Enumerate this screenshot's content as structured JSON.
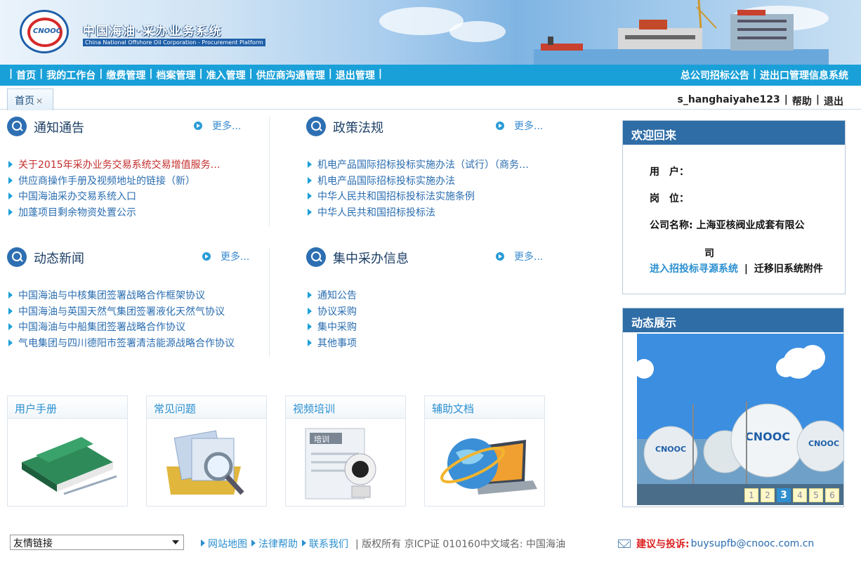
{
  "header": {
    "brand_title": "中国海油·采办业务系统",
    "brand_subtitle": "China National Offshore Oil Corporation - Procurement Platform",
    "logo_text": "CNOOC"
  },
  "nav": {
    "left": [
      "首页",
      "我的工作台",
      "缴费管理",
      "档案管理",
      "准入管理",
      "供应商沟通管理",
      "退出管理"
    ],
    "right": [
      "总公司招标公告",
      "进出口管理信息系统"
    ]
  },
  "tabs": {
    "home": "首页"
  },
  "userbar": {
    "username": "s_hanghaiyahe123",
    "help": "帮助",
    "logout": "退出"
  },
  "more_label": "更多...",
  "panels": {
    "notice": {
      "title": "通知通告",
      "items": [
        "关于2015年采办业务交易系统交易增值服务…",
        "供应商操作手册及视频地址的链接（新）",
        "中国海油采办交易系统入口",
        "加蓬项目剩余物资处置公示"
      ]
    },
    "policy": {
      "title": "政策法规",
      "items": [
        "机电产品国际招标投标实施办法（试行）（商务…",
        "机电产品国际招标投标实施办法",
        "中华人民共和国招标投标法实施条例",
        "中华人民共和国招标投标法"
      ]
    },
    "news": {
      "title": "动态新闻",
      "items": [
        "中国海油与中核集团签署战略合作框架协议",
        "中国海油与英国天然气集团签署液化天然气协议",
        "中国海油与中船集团签署战略合作协议",
        "气电集团与四川德阳市签署清洁能源战略合作协议"
      ]
    },
    "central": {
      "title": "集中采办信息",
      "items": [
        "通知公告",
        "协议采购",
        "集中采购",
        "其他事项"
      ]
    }
  },
  "tiles": [
    "用户手册",
    "常见问题",
    "视频培训",
    "辅助文档"
  ],
  "welcome": {
    "title": "欢迎回来",
    "user_label": "用　户：",
    "post_label": "岗　位：",
    "company_label": "公司名称:",
    "company_value": "上海亚核阀业成套有限公",
    "company_tail": "司",
    "link_bid": "进入招投标寻源系统",
    "link_migrate": "迁移旧系统附件"
  },
  "showcase": {
    "title": "动态展示",
    "tank_label": "CNOOC",
    "pages": [
      "1",
      "2",
      "3",
      "4",
      "5",
      "6"
    ],
    "active_page": "3"
  },
  "footer": {
    "friend_links": "友情链接",
    "links": [
      "网站地图",
      "法律帮助",
      "联系我们"
    ],
    "copyright": "| 版权所有 京ICP证 010160中文域名: 中国海油",
    "complaint_label": "建议与投诉:",
    "complaint_email": "buysupfb@cnooc.com.cn"
  },
  "colors": {
    "nav_bar": "#1aa0d8",
    "panel_head": "#2f6da6",
    "link": "#2a6db0",
    "alert": "#c42d2d"
  }
}
